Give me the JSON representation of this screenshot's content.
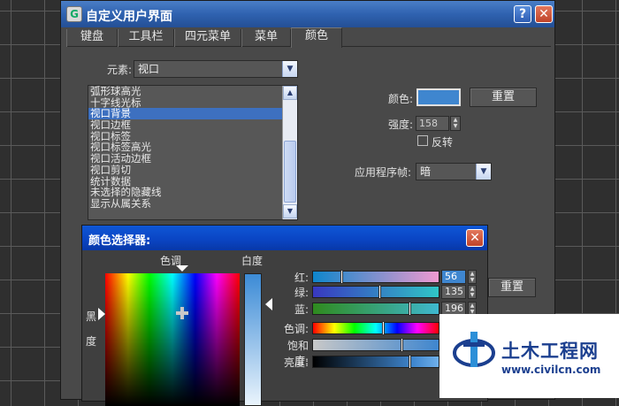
{
  "window": {
    "title": "自定义用户界面",
    "help": "?",
    "close": "✕"
  },
  "tabs": [
    "键盘",
    "工具栏",
    "四元菜单",
    "菜单",
    "颜色"
  ],
  "element": {
    "label": "元素:",
    "value": "视口"
  },
  "list": {
    "items": [
      "弧形球高光",
      "十字线光标",
      "视口背景",
      "视口边框",
      "视口标签",
      "视口标签高光",
      "视口活动边框",
      "视口剪切",
      "统计数据",
      "未选择的隐藏线",
      "显示从属关系"
    ],
    "selected_index": 2
  },
  "color_panel": {
    "color_label": "颜色:",
    "color_value": "#3f86cf",
    "reset_label": "重置",
    "intensity_label": "强度:",
    "intensity_value": "158",
    "invert_label": "反转",
    "app_frame_label": "应用程序帧:",
    "app_frame_value": "暗"
  },
  "color_picker": {
    "title": "颜色选择器:",
    "close": "✕",
    "hue_header": "色调",
    "whiteness_header": "白度",
    "black_label": "黑",
    "degree_label": "度",
    "reset_label": "重置",
    "sliders": [
      {
        "label": "红:",
        "value": "56",
        "fraction": 0.22
      },
      {
        "label": "绿:",
        "value": "135",
        "fraction": 0.53
      },
      {
        "label": "蓝:",
        "value": "196",
        "fraction": 0.77
      },
      {
        "label": "色调:",
        "value": "",
        "fraction": 0.56
      },
      {
        "label": "饱和度:",
        "value": "",
        "fraction": 0.71
      },
      {
        "label": "亮度:",
        "value": "",
        "fraction": 0.77
      }
    ]
  },
  "watermark": {
    "name": "土木工程网",
    "url": "www.civilcn.com"
  },
  "icons": {
    "app": "3ds-max-icon",
    "dropdown": "chevron-down-icon",
    "scroll_up": "chevron-up-icon",
    "scroll_down": "chevron-down-icon"
  }
}
